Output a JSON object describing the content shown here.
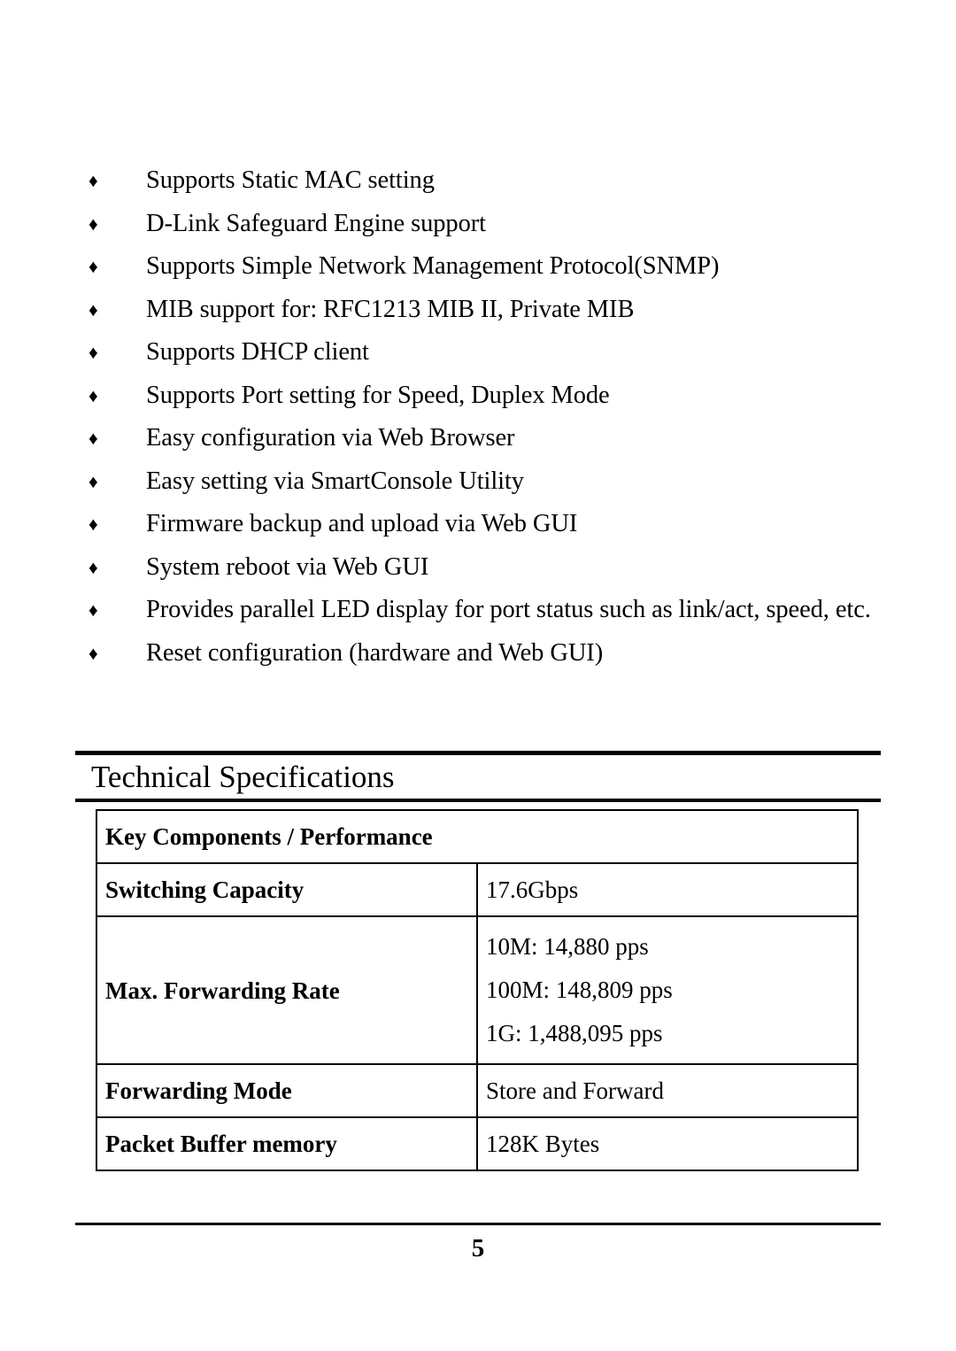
{
  "document": {
    "page_number": "5"
  },
  "features": {
    "bullet_glyph": "♦",
    "items": [
      "Supports Static MAC setting",
      "D-Link Safeguard Engine support",
      "Supports Simple Network Management Protocol(SNMP)",
      "MIB support for: RFC1213 MIB II, Private MIB",
      "Supports DHCP client",
      "Supports Port setting for Speed, Duplex Mode",
      "Easy configuration via Web Browser",
      "Easy setting via SmartConsole Utility",
      "Firmware backup and upload via Web GUI",
      "System reboot via Web GUI",
      "Provides parallel LED display for port status such as link/act, speed, etc.",
      "Reset configuration (hardware and Web GUI)"
    ]
  },
  "section": {
    "title": "Technical Specifications"
  },
  "spec_table": {
    "header": "Key Components / Performance",
    "rows": [
      {
        "label": "Switching Capacity",
        "value": "17.6Gbps",
        "value_lines": [
          "17.6Gbps"
        ]
      },
      {
        "label": "Max. Forwarding Rate",
        "value": "10M: 14,880 pps 100M: 148,809 pps 1G: 1,488,095 pps",
        "value_lines": [
          "10M: 14,880 pps",
          "100M: 148,809 pps",
          "1G: 1,488,095 pps"
        ]
      },
      {
        "label": "Forwarding Mode",
        "value": "Store and Forward",
        "value_lines": [
          "Store and Forward"
        ]
      },
      {
        "label": "Packet Buffer memory",
        "value": "128K Bytes",
        "value_lines": [
          "128K Bytes"
        ]
      }
    ]
  }
}
